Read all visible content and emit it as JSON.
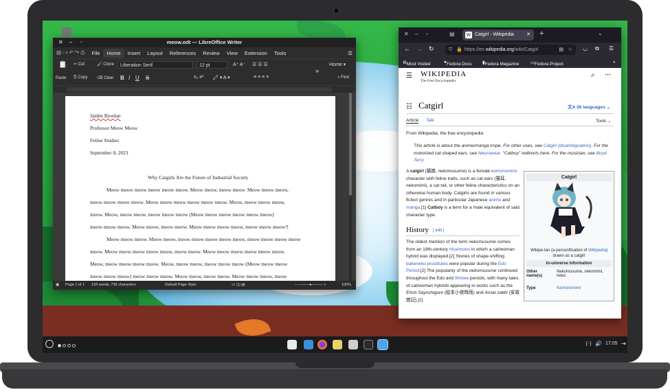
{
  "writer": {
    "title": "meow.odt — LibreOffice Writer",
    "menu": [
      "File",
      "Home",
      "Insert",
      "Layout",
      "References",
      "Review",
      "View",
      "Extension",
      "Tools"
    ],
    "active_menu": "Home",
    "toolbar": {
      "cut": "Cut",
      "paste": "Paste",
      "copy": "Copy",
      "clone": "Clone",
      "clear": "Clear",
      "font": "Liberation Serif",
      "size": "12 pt",
      "style_mode": "Home",
      "find": "Find"
    },
    "document": {
      "author": "Jaiden Riordan",
      "professor": "Professor Meow Meow",
      "course": "Feline Studies",
      "date": "September 8, 2023",
      "title": "Why Catgirls Are the Future of Industrial Society",
      "lines": [
        "Meow meow meow meow meow meow. Meow meow, meow meow.  Meow meow meow,",
        "meow meow meow meow. Meow meow meow meow meow meow. Meow, meow meow meow,",
        "meow. Meow,  meow meow, meow meow meow (Meow meow meow meow meow meow)",
        "meow meow meow. Meow meow, meow meow. Meow meow meow meow, meow meow meow!!",
        "Meow meow meow. Meow meow, meow meow meow meow meow, meow meow meow meow",
        "meow.  Meow meow meow meow meow, meow meow. Meow meow meow meow meow meow.",
        "Meow, meow meow meow meow. Meow,  meow meow, meow meow meow (Meow meow meow",
        "meow meow meow) meow meow meow. Meow meow, meow meow. Meow meow meow, meow"
      ]
    },
    "status": {
      "page": "Page 1 of 1",
      "words": "134 words, 736 characters",
      "style": "Default Page Style",
      "zoom": "100%"
    }
  },
  "browser": {
    "tab_title": "Catgirl - Wikipedia",
    "url_prefix": "https://en.",
    "url_host": "wikipedia.org",
    "url_path": "/wiki/Catgirl",
    "bookmarks": [
      "Most Visited",
      "Fedora Docs",
      "Fedora Magazine",
      "Fedora Project"
    ],
    "wiki": {
      "wordmark": "WIKIPEDIA",
      "tagline": "The Free Encyclopedia",
      "article_title": "Catgirl",
      "languages": "26 languages",
      "tab_article": "Article",
      "tab_talk": "Talk",
      "tools": "Tools",
      "from": "From Wikipedia, the free encyclopedia",
      "hatnote_1": "This article is about the anime/manga trope. For other uses, see ",
      "hatnote_link_1": "Catgirl (disambiguation)",
      "hatnote_2": ". For the motorized cat shaped ears, see ",
      "hatnote_link_2": "Neurowear",
      "hatnote_3": ". \"Catboy\" redirects here. For the musician, see ",
      "hatnote_link_3": "Boyd Terry",
      "intro": [
        {
          "t": "A "
        },
        {
          "t": "catgirl",
          "b": true
        },
        {
          "t": " (猫娘, "
        },
        {
          "t": "nekomusume",
          "i": true
        },
        {
          "t": ") is a female "
        },
        {
          "t": "kemonomimi",
          "l": true
        },
        {
          "t": " character with feline traits, such as cat ears (猫耳, "
        },
        {
          "t": "nekomimi",
          "i": true
        },
        {
          "t": "), a cat tail, or other feline characteristics on an otherwise human body. Catgirls are found in various fiction genres and in particular Japanese "
        },
        {
          "t": "anime",
          "l": true
        },
        {
          "t": " and "
        },
        {
          "t": "manga",
          "l": true
        },
        {
          "t": ".[1] "
        },
        {
          "t": "Catboy",
          "b": true
        },
        {
          "t": " is a term for a male equivalent of said character type."
        }
      ],
      "history_heading": "History",
      "edit": "edit",
      "history": [
        {
          "t": "The oldest mention of the term "
        },
        {
          "t": "nekomusume",
          "i": true
        },
        {
          "t": " comes from an 18th-century "
        },
        {
          "t": "misemono",
          "l": true
        },
        {
          "t": " in which a cat/woman hybrid was displayed.[2] Stories of shape-shifting "
        },
        {
          "t": "bakeneko prostitutes",
          "l": true
        },
        {
          "t": " were popular during the "
        },
        {
          "t": "Edo Period",
          "l": true
        },
        {
          "t": ".[2] The popularity of the "
        },
        {
          "t": "nekomusume",
          "i": true
        },
        {
          "t": " continued throughout the Edo and "
        },
        {
          "t": "Shōwa",
          "l": true
        },
        {
          "t": " periods, with many tales of cat/woman hybrids appearing in works such as the "
        },
        {
          "t": "Ehon Sayoshigure",
          "i": true
        },
        {
          "t": " (絵本小夜時雨) and "
        },
        {
          "t": "Ansei zakki",
          "i": true
        },
        {
          "t": " (安政雑記).[2]"
        }
      ],
      "infobox": {
        "title": "Catgirl",
        "caption_1": "Wikipe-tan (a personification of ",
        "caption_link": "Wikipedia",
        "caption_2": ") drawn as a catgirl",
        "section": "In-universe information",
        "other_names_k": "Other name(s)",
        "other_names_v": "Nekomusume, nekomimi, neko",
        "type_k": "Type",
        "type_v": "Kemonomimi"
      }
    }
  },
  "taskbar": {
    "time": "17:05"
  },
  "colors": {
    "wiki_link": "#3366cc",
    "firefox_chrome": "#2b2a33",
    "writer_chrome": "#2d2d2d"
  }
}
